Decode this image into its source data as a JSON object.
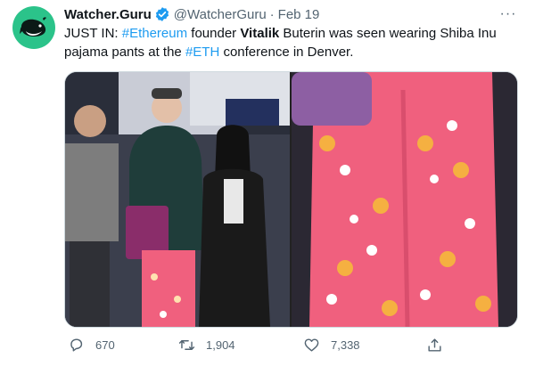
{
  "tweet": {
    "display_name": "Watcher.Guru",
    "handle": "@WatcherGuru",
    "separator": "·",
    "date": "Feb 19",
    "more_label": "···",
    "text": {
      "prefix": "JUST IN: ",
      "hashtag1": "#Ethereum",
      "mid1": " founder ",
      "bold_name": "Vitalik",
      "mid2": " Buterin was seen wearing Shiba Inu pajama pants at the ",
      "hashtag2": "#ETH",
      "suffix": " conference in Denver."
    },
    "stats": {
      "replies": "670",
      "retweets": "1,904",
      "likes": "7,338"
    }
  },
  "colors": {
    "brand_avatar": "#2bc38a",
    "link": "#1d9bf0",
    "muted": "#536471",
    "text": "#0f1419",
    "pajama_pink": "#f0607e"
  },
  "icons": [
    "whale-logo-icon",
    "verified-badge-icon",
    "more-icon",
    "reply-icon",
    "retweet-icon",
    "like-icon",
    "share-icon"
  ]
}
